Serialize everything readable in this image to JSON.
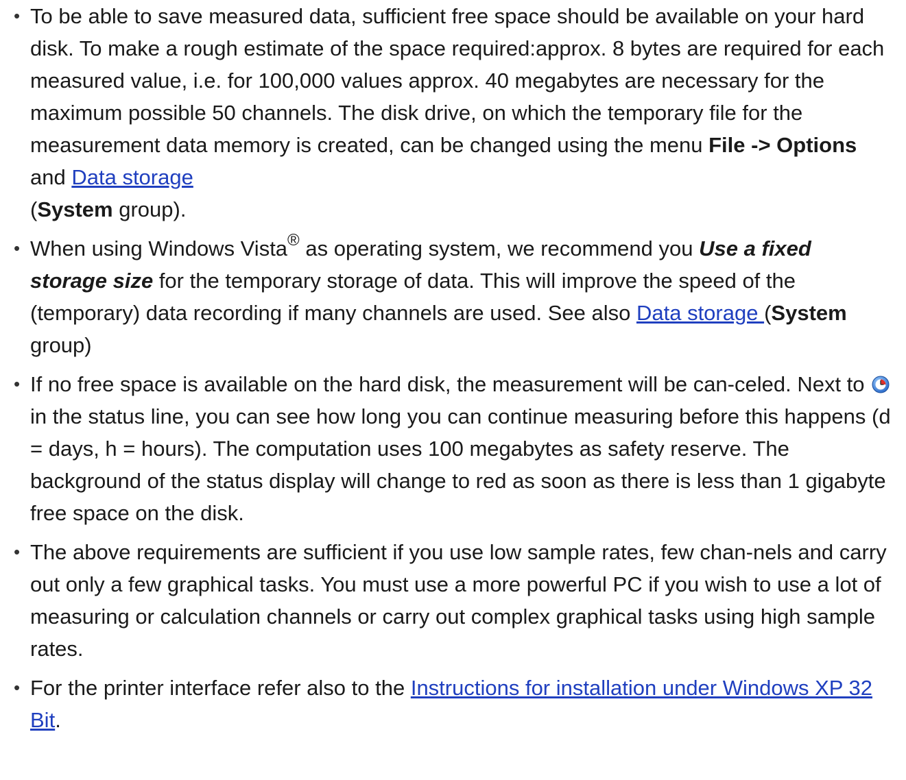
{
  "bullets": [
    {
      "text_1": "To be able to save measured data, sufficient free space should be available on your hard disk. To make a rough estimate of the space required:approx. 8 bytes are required for each measured value, i.e. for 100,000 values approx. 40 megabytes are necessary for the maximum possible 50 channels. The disk drive, on which the temporary file for the measurement data memory is created, can be changed using the menu ",
      "bold_1": "File -> Options",
      "text_2": " and ",
      "link_1": "Data storage ",
      "text_3": "(",
      "bold_2": "System",
      "text_4": " group)."
    },
    {
      "text_1": "When using Windows Vista",
      "sup": "®",
      "text_2": " as operating system, we recommend you ",
      "bold_italic": "Use a fixed storage size",
      "text_3": " for the temporary storage of data. This will improve the speed of the (temporary) data recording if many channels are used. See also ",
      "link_1": "Data storage ",
      "text_4": "(",
      "bold_1": "System",
      "text_5": " group)"
    },
    {
      "text_1": "If no free space is available on the hard disk, the measurement will be can-celed. Next to ",
      "icon": "clock-icon",
      "text_2": " in the status line, you can see how long you can continue measuring before this happens (d = days, h = hours). The computation uses 100 megabytes as safety reserve. The background of the status display will change to red as soon as there is less than 1 gigabyte free space on the disk."
    },
    {
      "text_1": "The above requirements are sufficient if you use low sample rates, few chan-nels and carry out only a few graphical tasks. You must use a more powerful PC if you wish to use a lot of measuring or calculation channels or carry out complex graphical tasks using high sample rates."
    },
    {
      "text_1": "For the printer interface refer also to the ",
      "link_1": "Instructions for installation under Windows XP 32 Bit",
      "text_2": "."
    }
  ],
  "colors": {
    "link": "#1f3fbf",
    "text": "#1a1a1a"
  }
}
